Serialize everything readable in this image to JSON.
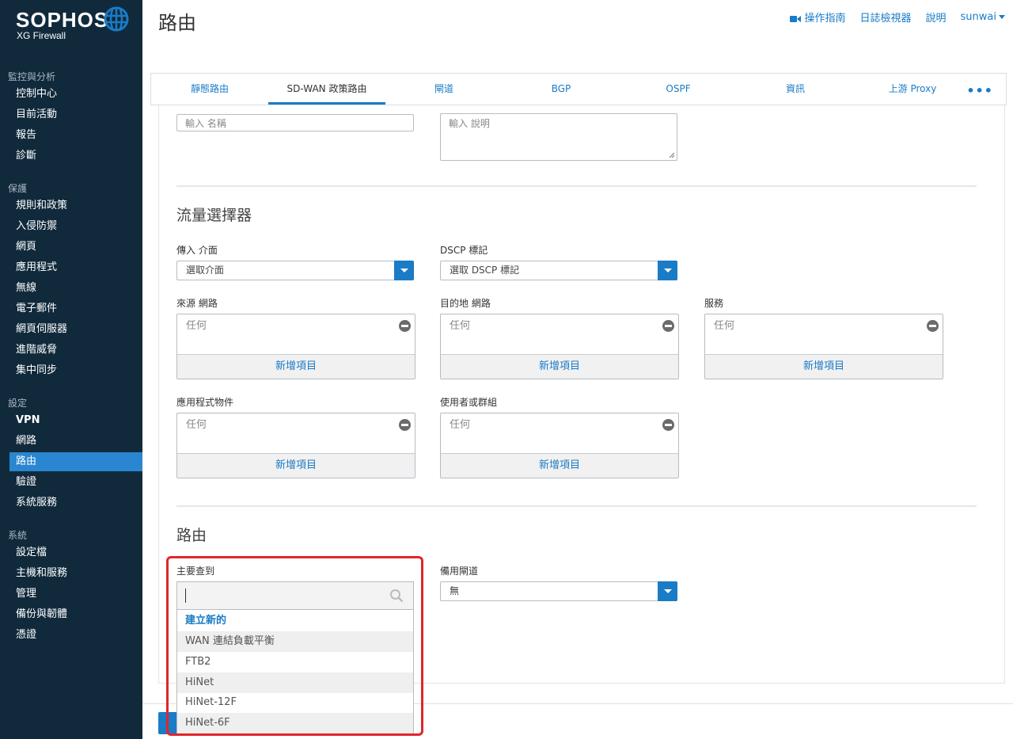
{
  "brand": {
    "name": "SOPHOS",
    "product": "XG Firewall"
  },
  "sidebar": {
    "sections": [
      {
        "title": "監控與分析",
        "items": [
          {
            "label": "控制中心"
          },
          {
            "label": "目前活動"
          },
          {
            "label": "報告"
          },
          {
            "label": "診斷"
          }
        ]
      },
      {
        "title": "保護",
        "items": [
          {
            "label": "規則和政策"
          },
          {
            "label": "入侵防禦"
          },
          {
            "label": "網頁"
          },
          {
            "label": "應用程式"
          },
          {
            "label": "無線"
          },
          {
            "label": "電子郵件"
          },
          {
            "label": "網頁伺服器"
          },
          {
            "label": "進階威脅"
          },
          {
            "label": "集中同步"
          }
        ]
      },
      {
        "title": "設定",
        "items": [
          {
            "label": "VPN"
          },
          {
            "label": "網路"
          },
          {
            "label": "路由",
            "active": true
          },
          {
            "label": "驗證"
          },
          {
            "label": "系統服務"
          }
        ]
      },
      {
        "title": "系統",
        "items": [
          {
            "label": "設定檔"
          },
          {
            "label": "主機和服務"
          },
          {
            "label": "管理"
          },
          {
            "label": "備份與韌體"
          },
          {
            "label": "憑證"
          }
        ]
      }
    ]
  },
  "header": {
    "title": "路由",
    "links": {
      "guide": "操作指南",
      "log_viewer": "日誌檢視器",
      "help": "說明",
      "user": "sunwai"
    }
  },
  "tabs": [
    {
      "label": "靜態路由"
    },
    {
      "label": "SD-WAN 政策路由",
      "active": true
    },
    {
      "label": "閘道"
    },
    {
      "label": "BGP"
    },
    {
      "label": "OSPF"
    },
    {
      "label": "資訊"
    },
    {
      "label": "上游 Proxy"
    }
  ],
  "tab_more": "•••",
  "form": {
    "name_placeholder": "輸入 名稱",
    "description_placeholder": "輸入 說明",
    "traffic_selector": {
      "title": "流量選擇器",
      "incoming_interface": {
        "label": "傳入 介面",
        "value": "選取介面"
      },
      "dscp_marking": {
        "label": "DSCP 標記",
        "value": "選取 DSCP 標記"
      },
      "source_networks": {
        "label": "來源 網路",
        "value": "任何",
        "add": "新增項目"
      },
      "destination_networks": {
        "label": "目的地 網路",
        "value": "任何",
        "add": "新增項目"
      },
      "services": {
        "label": "服務",
        "value": "任何",
        "add": "新增項目"
      },
      "application_object": {
        "label": "應用程式物件",
        "value": "任何",
        "add": "新增項目"
      },
      "users_or_groups": {
        "label": "使用者或群組",
        "value": "任何",
        "add": "新增項目"
      }
    },
    "routing": {
      "title": "路由",
      "primary_gateway": {
        "label": "主要查到",
        "search_value": "",
        "options": [
          {
            "label": "建立新的",
            "create": true
          },
          {
            "label": "WAN 連結負載平衡"
          },
          {
            "label": "FTB2"
          },
          {
            "label": "HiNet"
          },
          {
            "label": "HiNet-12F"
          },
          {
            "label": "HiNet-6F"
          }
        ]
      },
      "backup_gateway": {
        "label": "備用閘道",
        "value": "無"
      }
    }
  },
  "colors": {
    "sidebar_bg": "#102a3c",
    "accent": "#1a7bc6",
    "highlight": "#e0262b"
  }
}
